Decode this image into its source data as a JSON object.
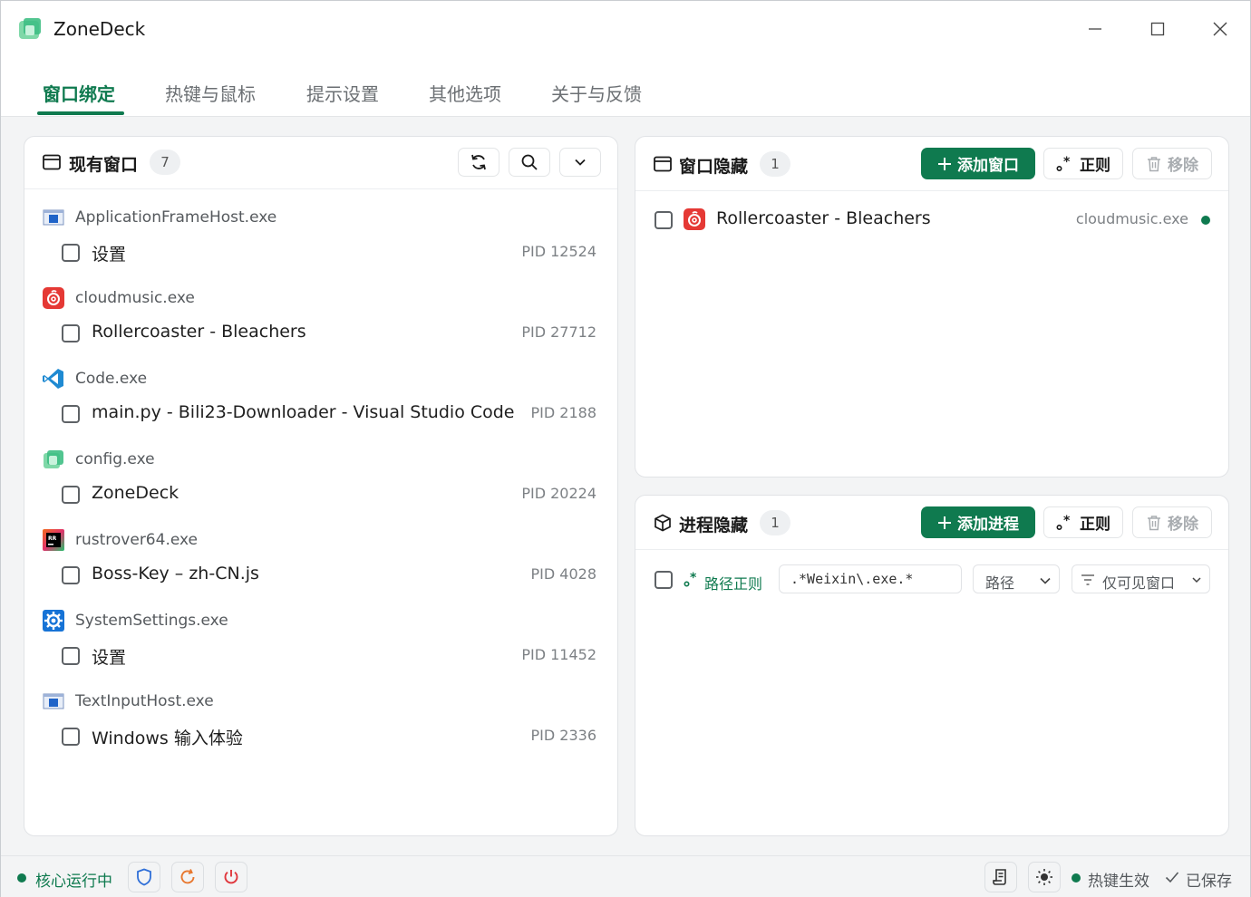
{
  "app": {
    "title": "ZoneDeck"
  },
  "tabs": [
    {
      "label": "窗口绑定",
      "active": true
    },
    {
      "label": "热键与鼠标"
    },
    {
      "label": "提示设置"
    },
    {
      "label": "其他选项"
    },
    {
      "label": "关于与反馈"
    }
  ],
  "left_panel": {
    "title": "现有窗口",
    "count": "7",
    "groups": [
      {
        "process": "ApplicationFrameHost.exe",
        "icon": "app-frame-icon",
        "window": "设置",
        "pid": "PID 12524"
      },
      {
        "process": "cloudmusic.exe",
        "icon": "cloudmusic-icon",
        "window": "Rollercoaster - Bleachers",
        "pid": "PID 27712"
      },
      {
        "process": "Code.exe",
        "icon": "vscode-icon",
        "window": "main.py - Bili23-Downloader - Visual Studio Code",
        "pid": "PID 2188"
      },
      {
        "process": "config.exe",
        "icon": "zonedeck-icon",
        "window": "ZoneDeck",
        "pid": "PID 20224"
      },
      {
        "process": "rustrover64.exe",
        "icon": "rustrover-icon",
        "window": "Boss-Key – zh-CN.js",
        "pid": "PID 4028"
      },
      {
        "process": "SystemSettings.exe",
        "icon": "settings-gear-icon",
        "window": "设置",
        "pid": "PID 11452"
      },
      {
        "process": "TextInputHost.exe",
        "icon": "app-frame-icon",
        "window": "Windows 输入体验",
        "pid": "PID 2336"
      }
    ]
  },
  "window_hide_panel": {
    "title": "窗口隐藏",
    "count": "1",
    "add_label": "添加窗口",
    "regex_label": "正则",
    "remove_label": "移除",
    "items": [
      {
        "title": "Rollercoaster - Bleachers",
        "process": "cloudmusic.exe"
      }
    ]
  },
  "process_hide_panel": {
    "title": "进程隐藏",
    "count": "1",
    "add_label": "添加进程",
    "regex_label": "正则",
    "remove_label": "移除",
    "rule": {
      "type_label": "路径正则",
      "pattern": ".*Weixin\\.exe.*",
      "match_field": "路径",
      "filter": "仅可见窗口"
    }
  },
  "footer": {
    "status": "核心运行中",
    "hotkey_status": "热键生效",
    "save_status": "已保存"
  },
  "colors": {
    "accent": "#0f7a4f",
    "danger": "#e0383e",
    "warn": "#e8772e",
    "info": "#2f6fd8"
  }
}
